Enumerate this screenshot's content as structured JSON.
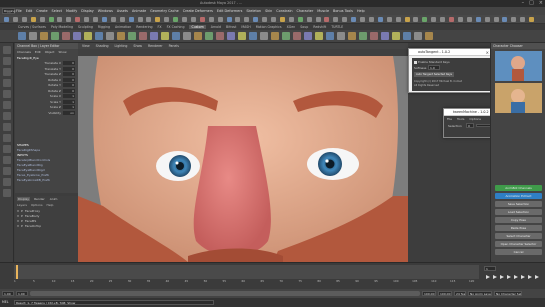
{
  "window": {
    "title": "Autodesk Maya 2017 - ..."
  },
  "menubar": {
    "mode": "Rigging",
    "items": [
      "File",
      "Edit",
      "Create",
      "Select",
      "Modify",
      "Display",
      "Windows",
      "Assets",
      "Animate",
      "Geometry Cache",
      "Create Deformers",
      "Edit Deformers",
      "Skeleton",
      "Skin",
      "Constrain",
      "Character",
      "Muscle",
      "Bonus Tools",
      "Help"
    ]
  },
  "shelf": {
    "tabs": [
      "Curves / Surfaces",
      "Poly Modeling",
      "Sculpting",
      "Rigging",
      "Animation",
      "Rendering",
      "FX",
      "FX Caching",
      "Custom",
      "Arnold",
      "Bifrost",
      "MASH",
      "Motion Graphics",
      "XGen",
      "Soup",
      "Redshift",
      "TURTLE"
    ],
    "active_tab": "Custom"
  },
  "outliner": {
    "title": "Channel Box / Layer Editor",
    "tabs": [
      "Channels",
      "Edit",
      "Object",
      "Show"
    ],
    "object": "FaceRig:R_Eye",
    "channels": [
      {
        "name": "Translate X",
        "value": "0"
      },
      {
        "name": "Translate Y",
        "value": "0"
      },
      {
        "name": "Translate Z",
        "value": "0"
      },
      {
        "name": "Rotate X",
        "value": "0"
      },
      {
        "name": "Rotate Y",
        "value": "0"
      },
      {
        "name": "Rotate Z",
        "value": "0"
      },
      {
        "name": "Scale X",
        "value": "1"
      },
      {
        "name": "Scale Y",
        "value": "1"
      },
      {
        "name": "Scale Z",
        "value": "1"
      },
      {
        "name": "Visibility",
        "value": "on"
      }
    ],
    "sections": [
      "SHAPES",
      "FaceRigRShape",
      "INPUTS",
      "FaceGrpBlendControls",
      "FaceEyeBlendRig",
      "FaceEyeBlendRigcl",
      "FaceL_Eyebrow_Prefb",
      "FaceEyebrowRB_Prefb"
    ]
  },
  "layers": {
    "tabs": [
      "Display",
      "Render",
      "Anim"
    ],
    "menu": [
      "Layers",
      "Options",
      "Help"
    ],
    "items": [
      "FaceProxy",
      "FaceBody",
      "FaceMS",
      "FaceOnTop"
    ]
  },
  "viewport": {
    "menus": [
      "View",
      "Shading",
      "Lighting",
      "Show",
      "Renderer",
      "Panels"
    ]
  },
  "dialog_main": {
    "title": "autoTangent - 1.0.2",
    "checkbox_label": "Enable Standard Keys",
    "softness_label": "Softness",
    "softness_value": "1.0",
    "button_label": "Auto Tangent Selected Keys",
    "footer": [
      "Copyright (c) 2017 Michael B. Comet",
      "All Rights Reserved"
    ]
  },
  "dialog_small": {
    "title": "tweenMachine - 1.0.2",
    "menus": [
      "File",
      "Tools",
      "Options"
    ],
    "selection_label": "Selection",
    "selection_value": "0"
  },
  "right_panel": {
    "title": "Character Chooser",
    "buttons": [
      {
        "label": "AnimBot Channels",
        "color": "#3f9b4a"
      },
      {
        "label": "Animation Extract",
        "color": "#2f7fc4"
      },
      {
        "label": "Save Selection",
        "color": "#6a6a6a"
      },
      {
        "label": "Load Selection",
        "color": "#6a6a6a"
      },
      {
        "label": "Copy Pose",
        "color": "#6a6a6a"
      },
      {
        "label": "Paste Pose",
        "color": "#6a6a6a"
      },
      {
        "label": "Select Character",
        "color": "#6a6a6a"
      },
      {
        "label": "Open Character Selector",
        "color": "#6a6a6a"
      },
      {
        "label": "Cancel",
        "color": "#6a6a6a"
      }
    ]
  },
  "timeline": {
    "ticks": [
      "1",
      "5",
      "10",
      "15",
      "20",
      "25",
      "30",
      "35",
      "40",
      "45",
      "50",
      "55",
      "60",
      "65",
      "70",
      "75",
      "80",
      "85",
      "90",
      "95",
      "100",
      "105",
      "110",
      "115",
      "120"
    ],
    "current_frame": "1"
  },
  "range": {
    "start": "1.00",
    "end": "100.00",
    "playback_start": "1.00",
    "playback_end": "100.00",
    "fps": "24 fps",
    "no_anim_layer": "No Anim Layer",
    "no_char_set": "No Character Set"
  },
  "command": {
    "lang": "MEL",
    "message": "Result: 1, 7 Tweens | Ctrl+B, TAB: Show"
  },
  "colors": {
    "skin": "#e0a78a",
    "nose": "#d96a6a",
    "beard": "#b2583d",
    "eye_iris": "#3f86b8",
    "accent": "#1f8fd6"
  }
}
